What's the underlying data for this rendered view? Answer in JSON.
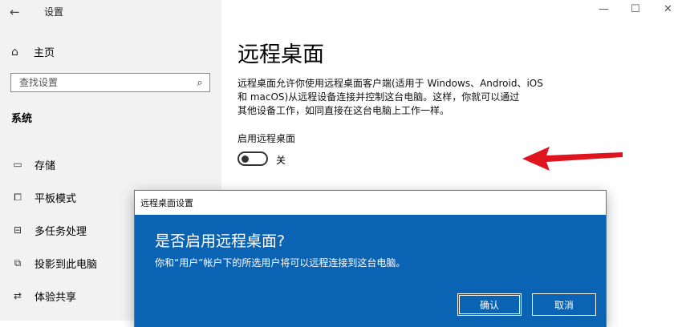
{
  "app": {
    "title": "设置",
    "back_glyph": "←"
  },
  "sidebar": {
    "home_label": "主页",
    "search_placeholder": "查找设置",
    "section_title": "系统",
    "items": [
      {
        "label": "存储",
        "icon": "storage-icon"
      },
      {
        "label": "平板模式",
        "icon": "tablet-mode-icon"
      },
      {
        "label": "多任务处理",
        "icon": "multitasking-icon"
      },
      {
        "label": "投影到此电脑",
        "icon": "projecting-icon"
      },
      {
        "label": "体验共享",
        "icon": "shared-experiences-icon"
      }
    ]
  },
  "window_controls": {
    "minimize": "—",
    "maximize": "☐",
    "close": "✕"
  },
  "main": {
    "title": "远程桌面",
    "description_line1": "远程桌面允许你使用远程桌面客户端(适用于 Windows、Android、iOS",
    "description_line2": "和 macOS)从远程设备连接并控制这台电脑。这样，你就可以通过",
    "description_line3": "其他设备工作，如同直接在这台电脑上工作一样。",
    "toggle_label": "启用远程桌面",
    "toggle_state": "关",
    "toggle_on": false
  },
  "dialog": {
    "title": "远程桌面设置",
    "heading": "是否启用远程桌面?",
    "message": "你和“用户”帐户下的所选用户将可以远程连接到这台电脑。",
    "confirm_label": "确认",
    "cancel_label": "取消"
  },
  "colors": {
    "accent": "#0a63b3",
    "arrow": "#e0141e",
    "sidebar_bg": "#f2f2f2"
  }
}
